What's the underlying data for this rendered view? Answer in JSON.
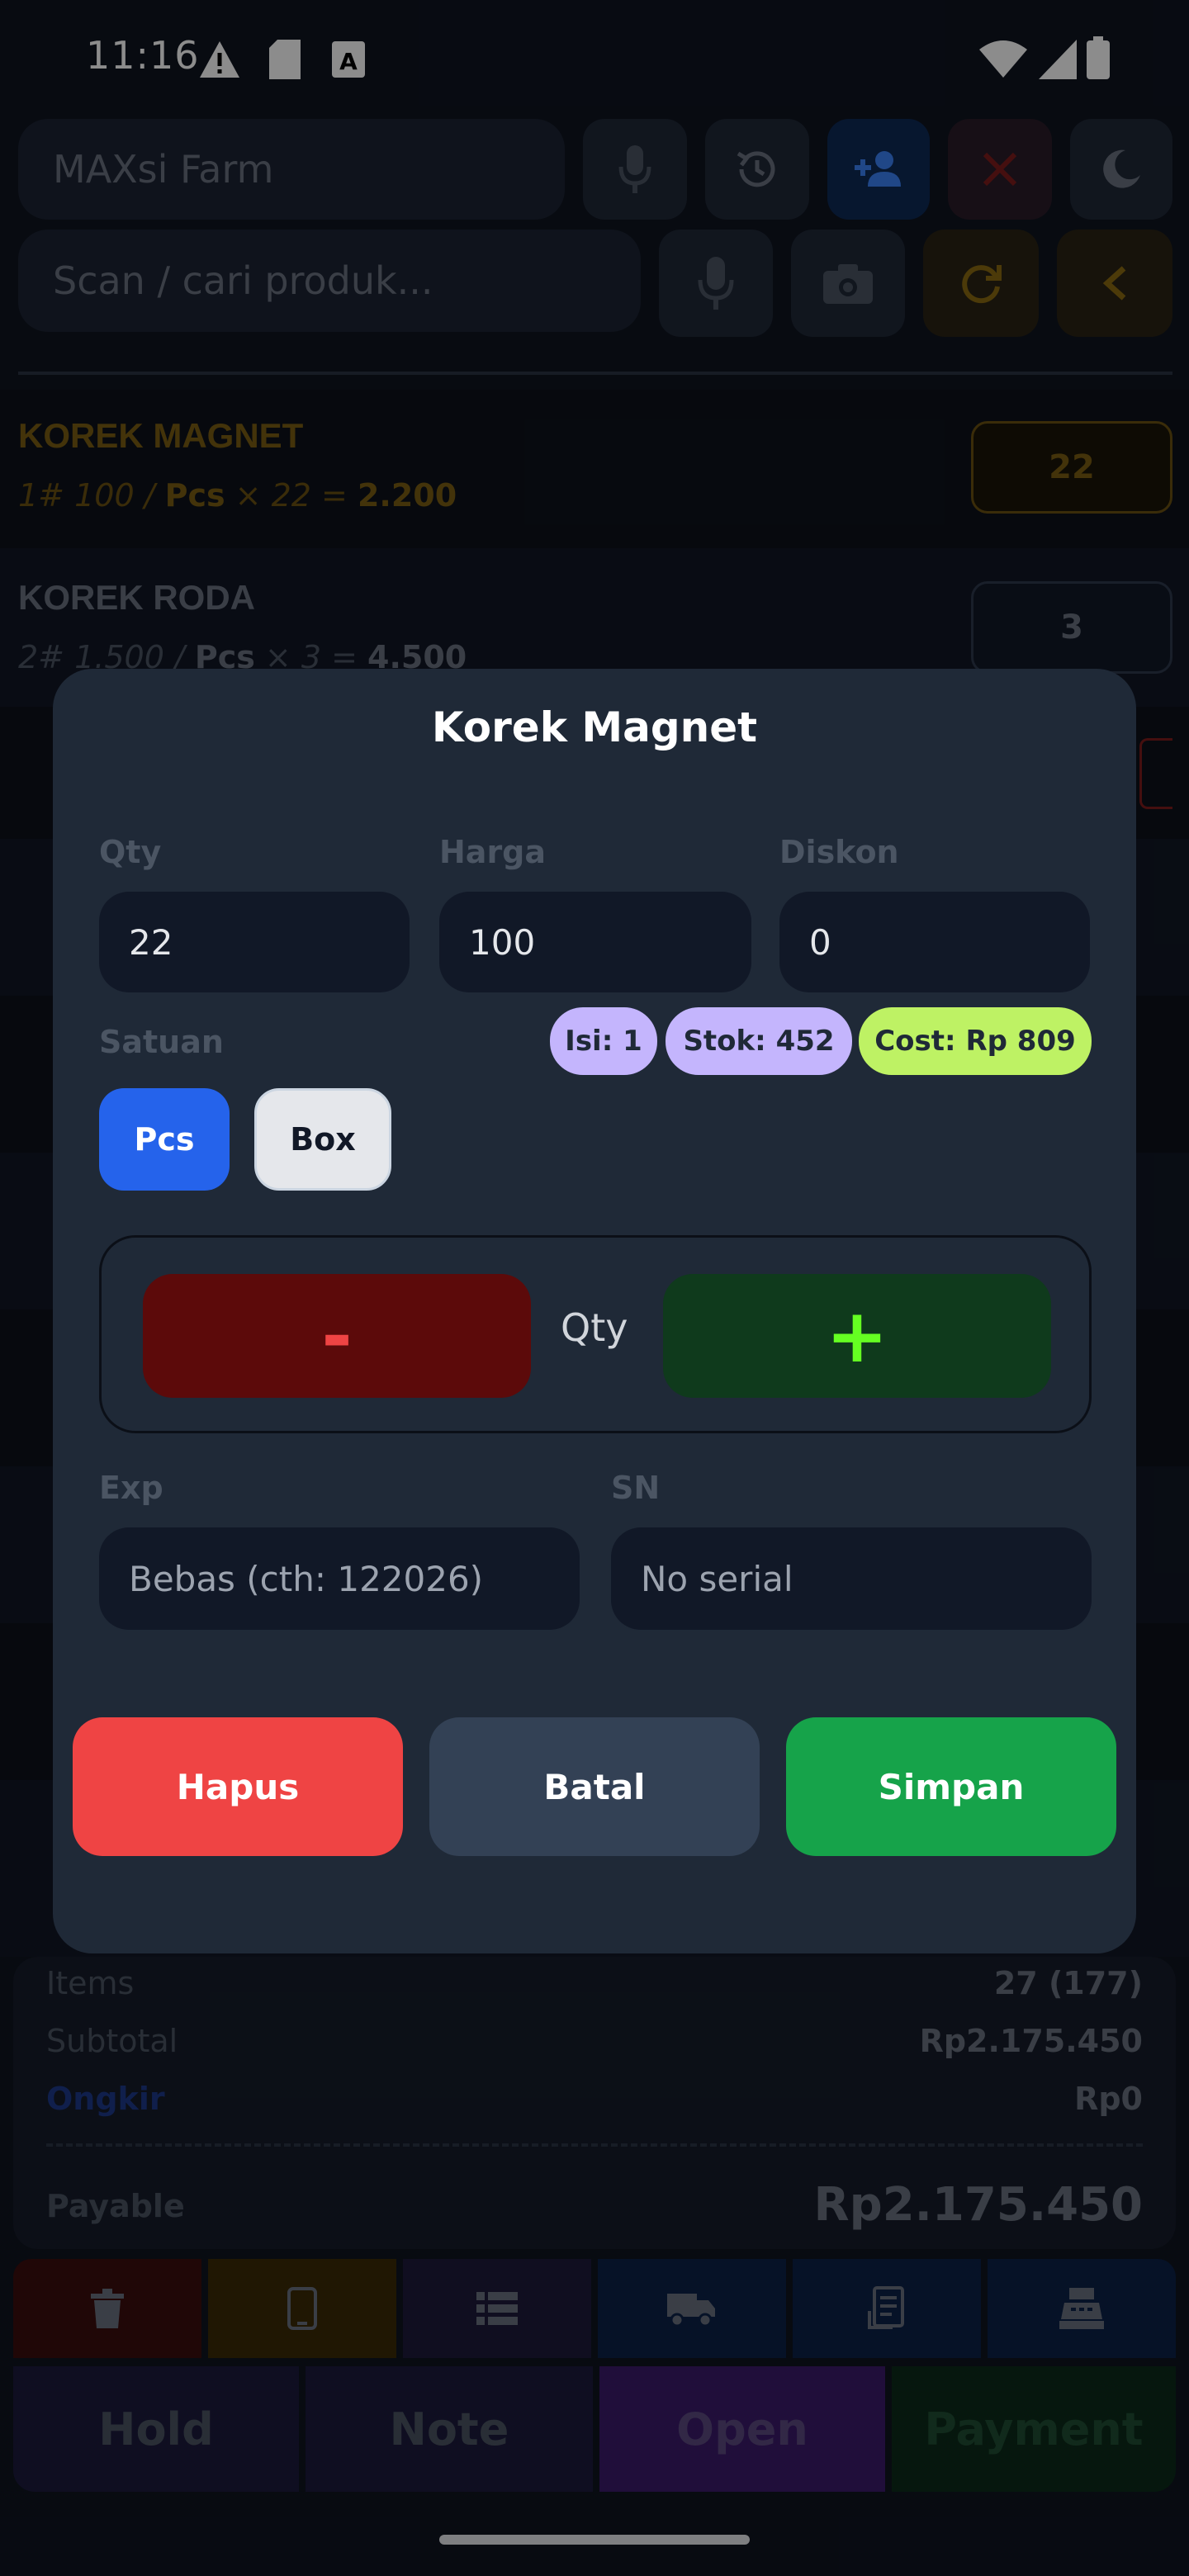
{
  "status_bar": {
    "time": "11:16"
  },
  "header": {
    "store_name": "MAXsi Farm",
    "search_placeholder": "Scan / cari produk..."
  },
  "items": [
    {
      "name": "KOREK MAGNET",
      "sub_prefix": "1# 100 / ",
      "unit": "Pcs",
      "sub_mid": " × 22 = ",
      "total": "2.200",
      "qty": "22"
    },
    {
      "name": "KOREK RODA",
      "sub_prefix": "2# 1.500 / ",
      "unit": "Pcs",
      "sub_mid": " × 3 = ",
      "total": "4.500",
      "qty": "3"
    }
  ],
  "modal": {
    "title": "Korek Magnet",
    "labels": {
      "qty": "Qty",
      "harga": "Harga",
      "diskon": "Diskon",
      "satuan": "Satuan",
      "exp": "Exp",
      "sn": "SN"
    },
    "values": {
      "qty": "22",
      "harga": "100",
      "diskon": "0"
    },
    "chips": {
      "isi": "Isi: 1",
      "stok": "Stok: 452",
      "cost": "Cost: Rp 809"
    },
    "units": [
      "Pcs",
      "Box"
    ],
    "stepper": {
      "minus": "-",
      "label": "Qty",
      "plus": "+"
    },
    "exp_placeholder": "Bebas (cth: 122026)",
    "sn_placeholder": "No serial",
    "buttons": {
      "hapus": "Hapus",
      "batal": "Batal",
      "simpan": "Simpan"
    }
  },
  "summary": {
    "items_label": "Items",
    "items_value": "27 (177)",
    "subtotal_label": "Subtotal",
    "subtotal_value": "Rp2.175.450",
    "ongkir_label": "Ongkir",
    "ongkir_value": "Rp0",
    "payable_label": "Payable",
    "payable_value": "Rp2.175.450"
  },
  "actions": [
    "Hold",
    "Note",
    "Open",
    "Payment"
  ],
  "colors": {
    "accent_blue": "#2563eb",
    "danger": "#ef4444",
    "success": "#16a34a",
    "lime": "#bef264",
    "lavender": "#c4b5fd",
    "gold": "#d4a017"
  }
}
